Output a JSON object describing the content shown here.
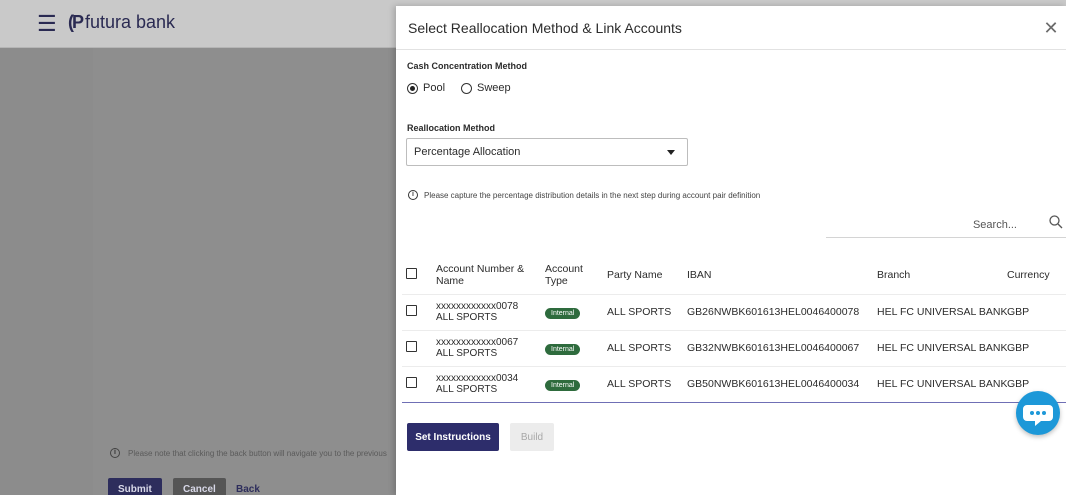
{
  "background": {
    "brand": "futura bank",
    "note": "Please note that clicking the back button will navigate you to the previous",
    "buttons": {
      "submit": "Submit",
      "cancel": "Cancel",
      "back": "Back"
    }
  },
  "panel": {
    "title": "Select Reallocation Method & Link Accounts",
    "close_icon": "close-icon",
    "cash_concentration": {
      "label": "Cash Concentration Method",
      "options": [
        "Pool",
        "Sweep"
      ],
      "selected": "Pool"
    },
    "reallocation": {
      "label": "Reallocation Method",
      "value": "Percentage Allocation"
    },
    "info_text": "Please capture the percentage distribution details in the next step during account pair definition",
    "search": {
      "placeholder": "Search..."
    },
    "table": {
      "headers": [
        "Account Number & Name",
        "Account Type",
        "Party Name",
        "IBAN",
        "Branch",
        "Currency"
      ],
      "rows": [
        {
          "account": "xxxxxxxxxxxx0078",
          "name": "ALL SPORTS",
          "type": "Internal",
          "party": "ALL SPORTS",
          "iban": "GB26NWBK601613HEL0046400078",
          "branch": "HEL FC UNIVERSAL BANK",
          "currency": "GBP"
        },
        {
          "account": "xxxxxxxxxxxx0067",
          "name": "ALL SPORTS",
          "type": "Internal",
          "party": "ALL SPORTS",
          "iban": "GB32NWBK601613HEL0046400067",
          "branch": "HEL FC UNIVERSAL BANK",
          "currency": "GBP"
        },
        {
          "account": "xxxxxxxxxxxx0034",
          "name": "ALL SPORTS",
          "type": "Internal",
          "party": "ALL SPORTS",
          "iban": "GB50NWBK601613HEL0046400034",
          "branch": "HEL FC UNIVERSAL BANK",
          "currency": "GBP"
        }
      ]
    },
    "buttons": {
      "set_instructions": "Set Instructions",
      "build": "Build"
    }
  },
  "colors": {
    "primary": "#2d2d6b",
    "badge_internal": "#2e6b3d",
    "chat": "#1d98d8"
  }
}
